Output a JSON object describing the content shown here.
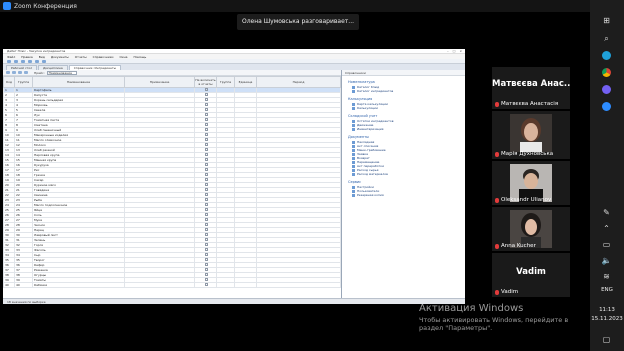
{
  "zoom": {
    "title": "Zoom Конференция",
    "speaker_banner": "Олена Шумовська разговаривает..."
  },
  "app": {
    "title": "Дебет Плюс - Закупка ингредиентов",
    "menu": [
      "Файл",
      "Правка",
      "Вид",
      "Документы",
      "Отчеты",
      "Справочники",
      "Окна",
      "Помощь"
    ],
    "tabs": [
      "Рабочий стол",
      "Дисциплина",
      "Справочник: Ингредиенты"
    ],
    "price_label": "Прайс:",
    "price_value": "Наименование",
    "columns": [
      "Код",
      "Группа",
      "Наименование",
      "Примечание",
      "Не включать в отчеты",
      "Группа",
      "Единица",
      "Период"
    ],
    "rows": [
      [
        "1",
        "1",
        "Картофель"
      ],
      [
        "2",
        "2",
        "Капуста"
      ],
      [
        "3",
        "3",
        "Корень сельдерея"
      ],
      [
        "4",
        "4",
        "Морковь"
      ],
      [
        "5",
        "5",
        "Свекла"
      ],
      [
        "6",
        "6",
        "Лук"
      ],
      [
        "7",
        "7",
        "Томатная паста"
      ],
      [
        "8",
        "8",
        "Сметана"
      ],
      [
        "9",
        "9",
        "Хлеб пшеничный"
      ],
      [
        "10",
        "10",
        "Макаронные изделия"
      ],
      [
        "11",
        "11",
        "Масло сливочное"
      ],
      [
        "12",
        "12",
        "Молоко"
      ],
      [
        "13",
        "13",
        "Хлеб ржаной"
      ],
      [
        "14",
        "14",
        "Перловая крупа"
      ],
      [
        "15",
        "15",
        "Манная крупа"
      ],
      [
        "16",
        "16",
        "Кукуруза"
      ],
      [
        "17",
        "17",
        "Рис"
      ],
      [
        "18",
        "18",
        "Гречка"
      ],
      [
        "19",
        "19",
        "Сахар"
      ],
      [
        "20",
        "20",
        "Куриное мясо"
      ],
      [
        "21",
        "21",
        "Говядина"
      ],
      [
        "22",
        "22",
        "Свинина"
      ],
      [
        "23",
        "23",
        "Рыба"
      ],
      [
        "24",
        "24",
        "Масло подсолнечное"
      ],
      [
        "25",
        "25",
        "Яйца"
      ],
      [
        "26",
        "26",
        "Соль"
      ],
      [
        "27",
        "27",
        "Мука"
      ],
      [
        "28",
        "28",
        "Чеснок"
      ],
      [
        "29",
        "29",
        "Перец"
      ],
      [
        "30",
        "30",
        "Лавровый лист"
      ],
      [
        "31",
        "31",
        "Зелень"
      ],
      [
        "32",
        "32",
        "Горох"
      ],
      [
        "33",
        "33",
        "Фасоль"
      ],
      [
        "34",
        "34",
        "Сыр"
      ],
      [
        "35",
        "35",
        "Творог"
      ],
      [
        "36",
        "36",
        "Кефир"
      ],
      [
        "37",
        "37",
        "Ряженка"
      ],
      [
        "38",
        "38",
        "Огурцы"
      ],
      [
        "39",
        "39",
        "Томаты"
      ],
      [
        "40",
        "40",
        "Кабачки"
      ]
    ],
    "right_pane": {
      "header": "Справочники",
      "sections": [
        {
          "title": "Номенклатура",
          "items": [
            "Каталог блюд",
            "Каталог ингредиентов"
          ]
        },
        {
          "title": "Калькуляция",
          "items": [
            "Карта калькуляции",
            "Калькуляции"
          ]
        },
        {
          "title": "Складской учет",
          "items": [
            "Остатки ингредиентов",
            "Движение",
            "Инвентаризация"
          ]
        },
        {
          "title": "Документы",
          "items": [
            "Накладная",
            "Акт списания",
            "Меню-требование",
            "Заявка",
            "Возврат",
            "Перемещение",
            "Акт переработки",
            "Расход сырья",
            "Расход материалов"
          ]
        },
        {
          "title": "Сервис",
          "items": [
            "Настройки",
            "Пользователи",
            "Резервная копия"
          ]
        }
      ]
    },
    "status_bar": "18 значения по выборке"
  },
  "participants": [
    {
      "name": "Матвєєва Анастасія",
      "big_name": "Матвєєва Анас..."
    },
    {
      "name": "Марія Духновська"
    },
    {
      "name": "Oleksandr Ulianov"
    },
    {
      "name": "Anna Kucher"
    },
    {
      "name": "Vadim",
      "big_name": "Vadim"
    }
  ],
  "activation": {
    "title": "Активация Windows",
    "line1": "Чтобы активировать Windows, перейдите в",
    "line2": "раздел \"Параметры\"."
  },
  "taskbar": {
    "lang": "ENG",
    "time": "11:13",
    "date": "15.11.2023"
  },
  "colors": {
    "zoom_blue": "#2d8cff",
    "tile_bg": "#1a1a1a",
    "mute_red": "#e23b3b"
  }
}
